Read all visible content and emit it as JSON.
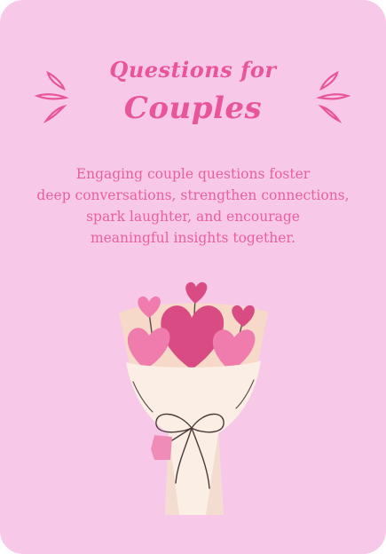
{
  "card": {
    "title_line1": "Questions for",
    "title_line2": "Couples",
    "description_lines": [
      "Engaging couple questions foster",
      "deep conversations, strengthen connections,",
      "spark laughter, and encourage",
      "meaningful insights together."
    ]
  },
  "colors": {
    "background": "#f7c8e8",
    "accent": "#e8559b",
    "wrapper": "#fbeee4",
    "heart_dark": "#d94c83",
    "heart_light": "#f07cae",
    "tag": "#f08db6"
  },
  "icons": [
    "sparkle-icon",
    "bouquet-icon",
    "heart-icon",
    "ribbon-icon",
    "tag-icon"
  ]
}
